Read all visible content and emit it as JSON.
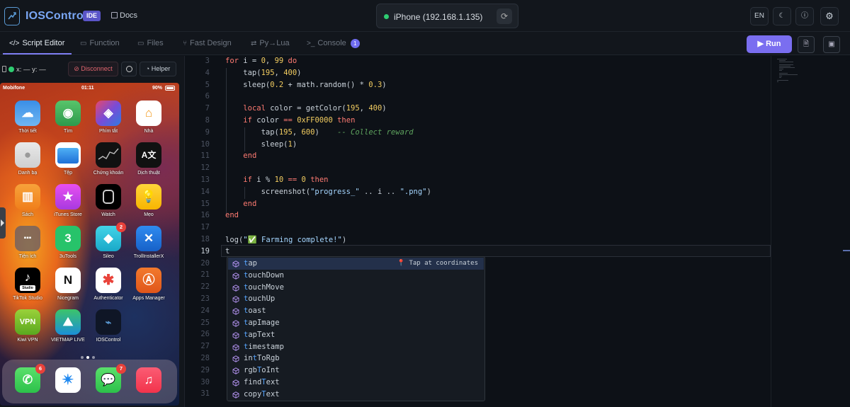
{
  "header": {
    "brand": "IOSControl",
    "badge": "IDE",
    "docs": "Docs",
    "device_name": "iPhone (192.168.1.135)",
    "device_status_color": "#2ecc71",
    "language": "EN"
  },
  "tabs": [
    {
      "label": "Script Editor",
      "icon": "code-icon"
    },
    {
      "label": "Function",
      "icon": "function-icon"
    },
    {
      "label": "Files",
      "icon": "folder-icon"
    },
    {
      "label": "Fast Design",
      "icon": "design-icon"
    },
    {
      "label": "Py→Lua",
      "icon": "convert-icon"
    },
    {
      "label": "Console",
      "icon": "terminal-icon",
      "badge": "1"
    }
  ],
  "toolbar": {
    "run_label": "Run",
    "accent_color": "#7a6ef0"
  },
  "device_controls": {
    "coords": "x: — y: —",
    "disconnect": "Disconnect",
    "helper": "Helper"
  },
  "phone": {
    "carrier": "Mobifone",
    "time": "01:11",
    "battery": "90%",
    "apps": [
      {
        "label": "Thời tiết"
      },
      {
        "label": "Tìm"
      },
      {
        "label": "Phím tắt"
      },
      {
        "label": "Nhà"
      },
      {
        "label": "Danh bạ"
      },
      {
        "label": "Tệp"
      },
      {
        "label": "Chứng khoán"
      },
      {
        "label": "Dịch thuật"
      },
      {
        "label": "Sách"
      },
      {
        "label": "iTunes Store"
      },
      {
        "label": "Watch"
      },
      {
        "label": "Mẹo"
      },
      {
        "label": "Tiện ích"
      },
      {
        "label": "3uTools"
      },
      {
        "label": "Sileo",
        "badge": "2"
      },
      {
        "label": "TrollInstallerX"
      },
      {
        "label": "TikTok Studio",
        "icon_text": "Studio"
      },
      {
        "label": "Nicegram"
      },
      {
        "label": "Authenticator"
      },
      {
        "label": "Apps Manager"
      },
      {
        "label": "Kiwi VPN",
        "icon_text": "VPN"
      },
      {
        "label": "VIETMAP LIVE"
      },
      {
        "label": "IOSControl"
      }
    ],
    "dock": [
      {
        "name": "phone-app",
        "badge": "6"
      },
      {
        "name": "safari-app"
      },
      {
        "name": "messages-app",
        "badge": "7"
      },
      {
        "name": "music-app"
      }
    ]
  },
  "editor": {
    "lines": [
      {
        "n": "3",
        "t": "for i = 0, 99 do"
      },
      {
        "n": "4",
        "t": "    tap(195, 400)"
      },
      {
        "n": "5",
        "t": "    sleep(0.2 + math.random() * 0.3)"
      },
      {
        "n": "6",
        "t": ""
      },
      {
        "n": "7",
        "t": "    local color = getColor(195, 400)"
      },
      {
        "n": "8",
        "t": "    if color == 0xFF0000 then"
      },
      {
        "n": "9",
        "t": "        tap(195, 600)    -- Collect reward"
      },
      {
        "n": "10",
        "t": "        sleep(1)"
      },
      {
        "n": "11",
        "t": "    end"
      },
      {
        "n": "12",
        "t": ""
      },
      {
        "n": "13",
        "t": "    if i % 10 == 0 then"
      },
      {
        "n": "14",
        "t": "        screenshot(\"progress_\" .. i .. \".png\")"
      },
      {
        "n": "15",
        "t": "    end"
      },
      {
        "n": "16",
        "t": "end"
      },
      {
        "n": "17",
        "t": ""
      },
      {
        "n": "18",
        "t": "log(\"✅ Farming complete!\")"
      },
      {
        "n": "19",
        "t": "t"
      },
      {
        "n": "20",
        "t": ""
      },
      {
        "n": "21",
        "t": ""
      },
      {
        "n": "22",
        "t": ""
      },
      {
        "n": "23",
        "t": ""
      },
      {
        "n": "24",
        "t": ""
      },
      {
        "n": "25",
        "t": ""
      },
      {
        "n": "26",
        "t": ""
      },
      {
        "n": "27",
        "t": ""
      },
      {
        "n": "28",
        "t": ""
      },
      {
        "n": "29",
        "t": ""
      },
      {
        "n": "30",
        "t": ""
      },
      {
        "n": "31",
        "t": ""
      }
    ],
    "current_line": "19",
    "autocomplete": {
      "items": [
        "tap",
        "touchDown",
        "touchMove",
        "touchUp",
        "toast",
        "tapImage",
        "tapText",
        "timestamp",
        "intToRgb",
        "rgbToInt",
        "findText",
        "copyText"
      ],
      "selected_detail": "📍 Tap at coordinates"
    }
  }
}
